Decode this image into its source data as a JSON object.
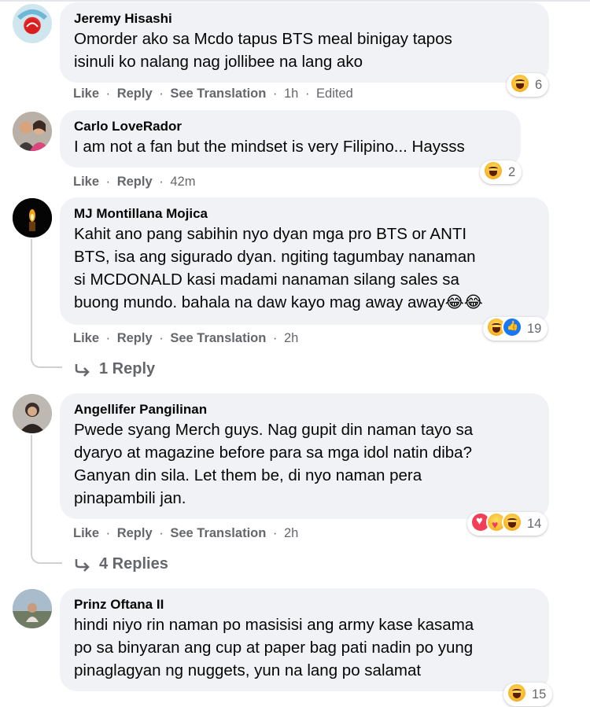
{
  "comments": [
    {
      "name": "Jeremy Hisashi",
      "lines": [
        "Omorder ako sa Mcdo tapus BTS meal binigay tapos",
        "isinuli ko nalang nag jollibee na lang ako"
      ],
      "like": "Like",
      "reply": "Reply",
      "translate": "See Translation",
      "time": "1h",
      "edited": "Edited",
      "reaction_count": "6"
    },
    {
      "name": "Carlo LoveRador",
      "lines": [
        "I am not a fan but the mindset is very Filipino... Haysss"
      ],
      "like": "Like",
      "reply": "Reply",
      "time": "42m",
      "reaction_count": "2"
    },
    {
      "name": "MJ Montillana Mojica",
      "lines": [
        "Kahit ano pang sabihin nyo dyan mga pro BTS or ANTI",
        "BTS, isa ang sigurado dyan. ngiting tagumbay nanaman",
        "si MCDONALD kasi madami nanaman silang sales sa",
        "buong mundo. bahala na daw kayo mag away away😂😂"
      ],
      "like": "Like",
      "reply": "Reply",
      "translate": "See Translation",
      "time": "2h",
      "reaction_count": "19",
      "replies": "1 Reply"
    },
    {
      "name": "Angellifer Pangilinan",
      "lines": [
        "Pwede syang Merch guys. Nag gupit din naman tayo sa",
        "dyaryo at magazine before para sa mga idol natin diba?",
        "Ganyan din sila. Let them be, di nyo naman pera",
        "pinapambili jan."
      ],
      "like": "Like",
      "reply": "Reply",
      "translate": "See Translation",
      "time": "2h",
      "reaction_count": "14",
      "replies": "4 Replies"
    },
    {
      "name": "Prinz Oftana II",
      "lines": [
        "hindi niyo rin naman po masisisi ang army kase kasama",
        "po sa binyaran ang cup at paper bag pati nadin po yung",
        "pinaglagyan ng nuggets, yun na lang po salamat"
      ],
      "reaction_count": "15"
    }
  ],
  "separator": "·",
  "icons": {
    "haha": "haha-reaction-icon",
    "like": "like-reaction-icon",
    "love": "love-reaction-icon",
    "care": "care-reaction-icon",
    "reply_arrow": "reply-arrow-icon"
  },
  "colors": {
    "bubble": "#f0f2f5",
    "meta_text": "#65676b",
    "thread_line": "#ced0d4"
  }
}
